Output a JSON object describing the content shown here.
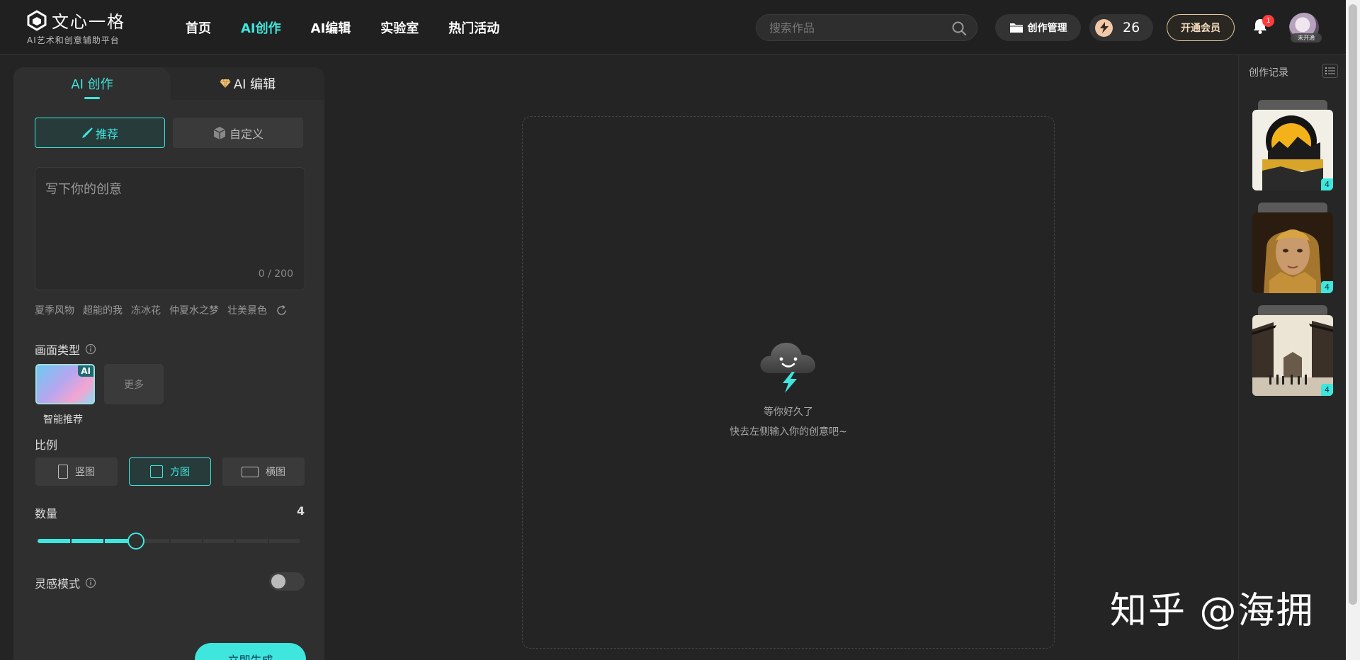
{
  "brand": {
    "title": "文心一格",
    "subtitle": "AI艺术和创意辅助平台"
  },
  "nav": {
    "items": [
      {
        "label": "首页",
        "active": false
      },
      {
        "label": "AI创作",
        "active": true
      },
      {
        "label": "AI编辑",
        "active": false
      },
      {
        "label": "实验室",
        "active": false
      },
      {
        "label": "热门活动",
        "active": false
      }
    ]
  },
  "search": {
    "placeholder": "搜索作品",
    "value": ""
  },
  "header": {
    "manage_label": "创作管理",
    "credits": "26",
    "vip_label": "开通会员",
    "notification_count": "1",
    "avatar_tag": "未开通"
  },
  "panel": {
    "tabs": [
      {
        "label": "AI 创作",
        "active": true
      },
      {
        "label": "AI 编辑",
        "active": false
      }
    ],
    "modes": {
      "recommend": "推荐",
      "custom": "自定义"
    },
    "prompt": {
      "placeholder": "写下你的创意",
      "value": "",
      "counter": "0 / 200"
    },
    "suggestions": [
      "夏季风物",
      "超能的我",
      "冻冰花",
      "仲夏水之梦",
      "壮美景色"
    ],
    "style_type": {
      "label": "画面类型",
      "selected": "智能推荐",
      "badge": "AI",
      "more": "更多"
    },
    "ratio": {
      "label": "比例",
      "options": [
        {
          "label": "竖图",
          "active": false
        },
        {
          "label": "方图",
          "active": true
        },
        {
          "label": "横图",
          "active": false
        }
      ]
    },
    "quantity": {
      "label": "数量",
      "value": 4,
      "min": 1,
      "max": 9,
      "display": "4"
    },
    "inspiration": {
      "label": "灵感模式",
      "enabled": false
    },
    "generate_label": "立即生成"
  },
  "canvas": {
    "empty_title": "等你好久了",
    "empty_hint": "快去左侧输入你的创意吧~"
  },
  "history": {
    "title": "创作记录",
    "items": [
      {
        "count": "4"
      },
      {
        "count": "4"
      },
      {
        "count": "4"
      }
    ]
  },
  "watermark": "知乎 @海拥",
  "colors": {
    "accent": "#3ee6dd",
    "background": "#242424",
    "panel": "#2f2f2f",
    "vip": "#e5c9a2"
  }
}
